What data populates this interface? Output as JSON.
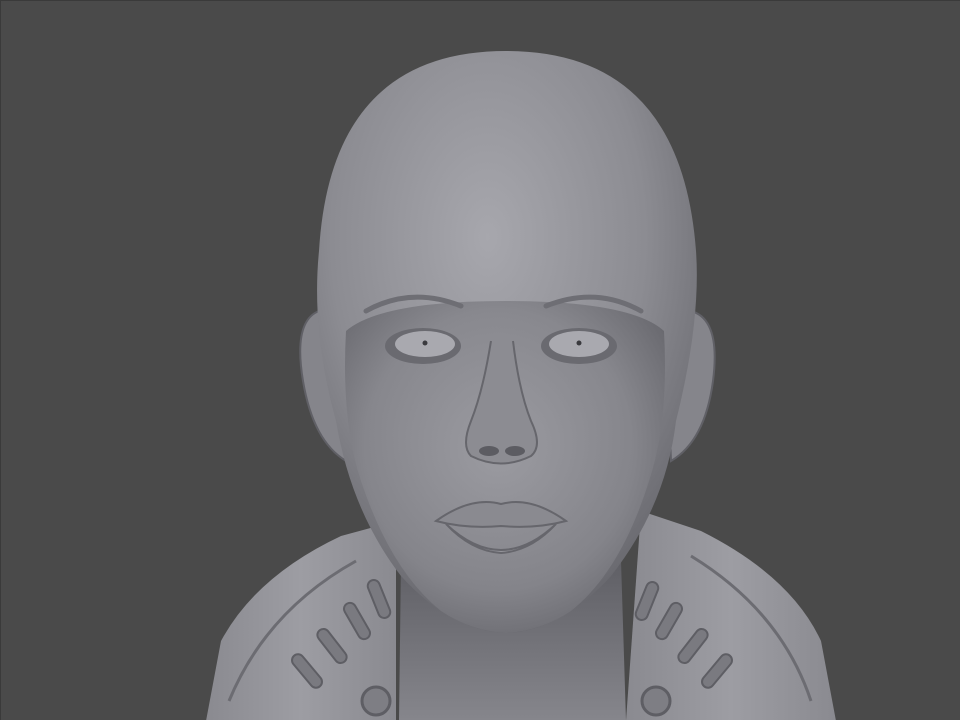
{
  "viewport": {
    "background_color": "#4a4a4a",
    "model_color": "#8e8e94"
  },
  "scene": {
    "subject": "sculpted-head-bust",
    "icons": {
      "canvas": "sculpt-canvas",
      "head": "head-mesh",
      "collar": "armor-collar-mesh"
    }
  }
}
